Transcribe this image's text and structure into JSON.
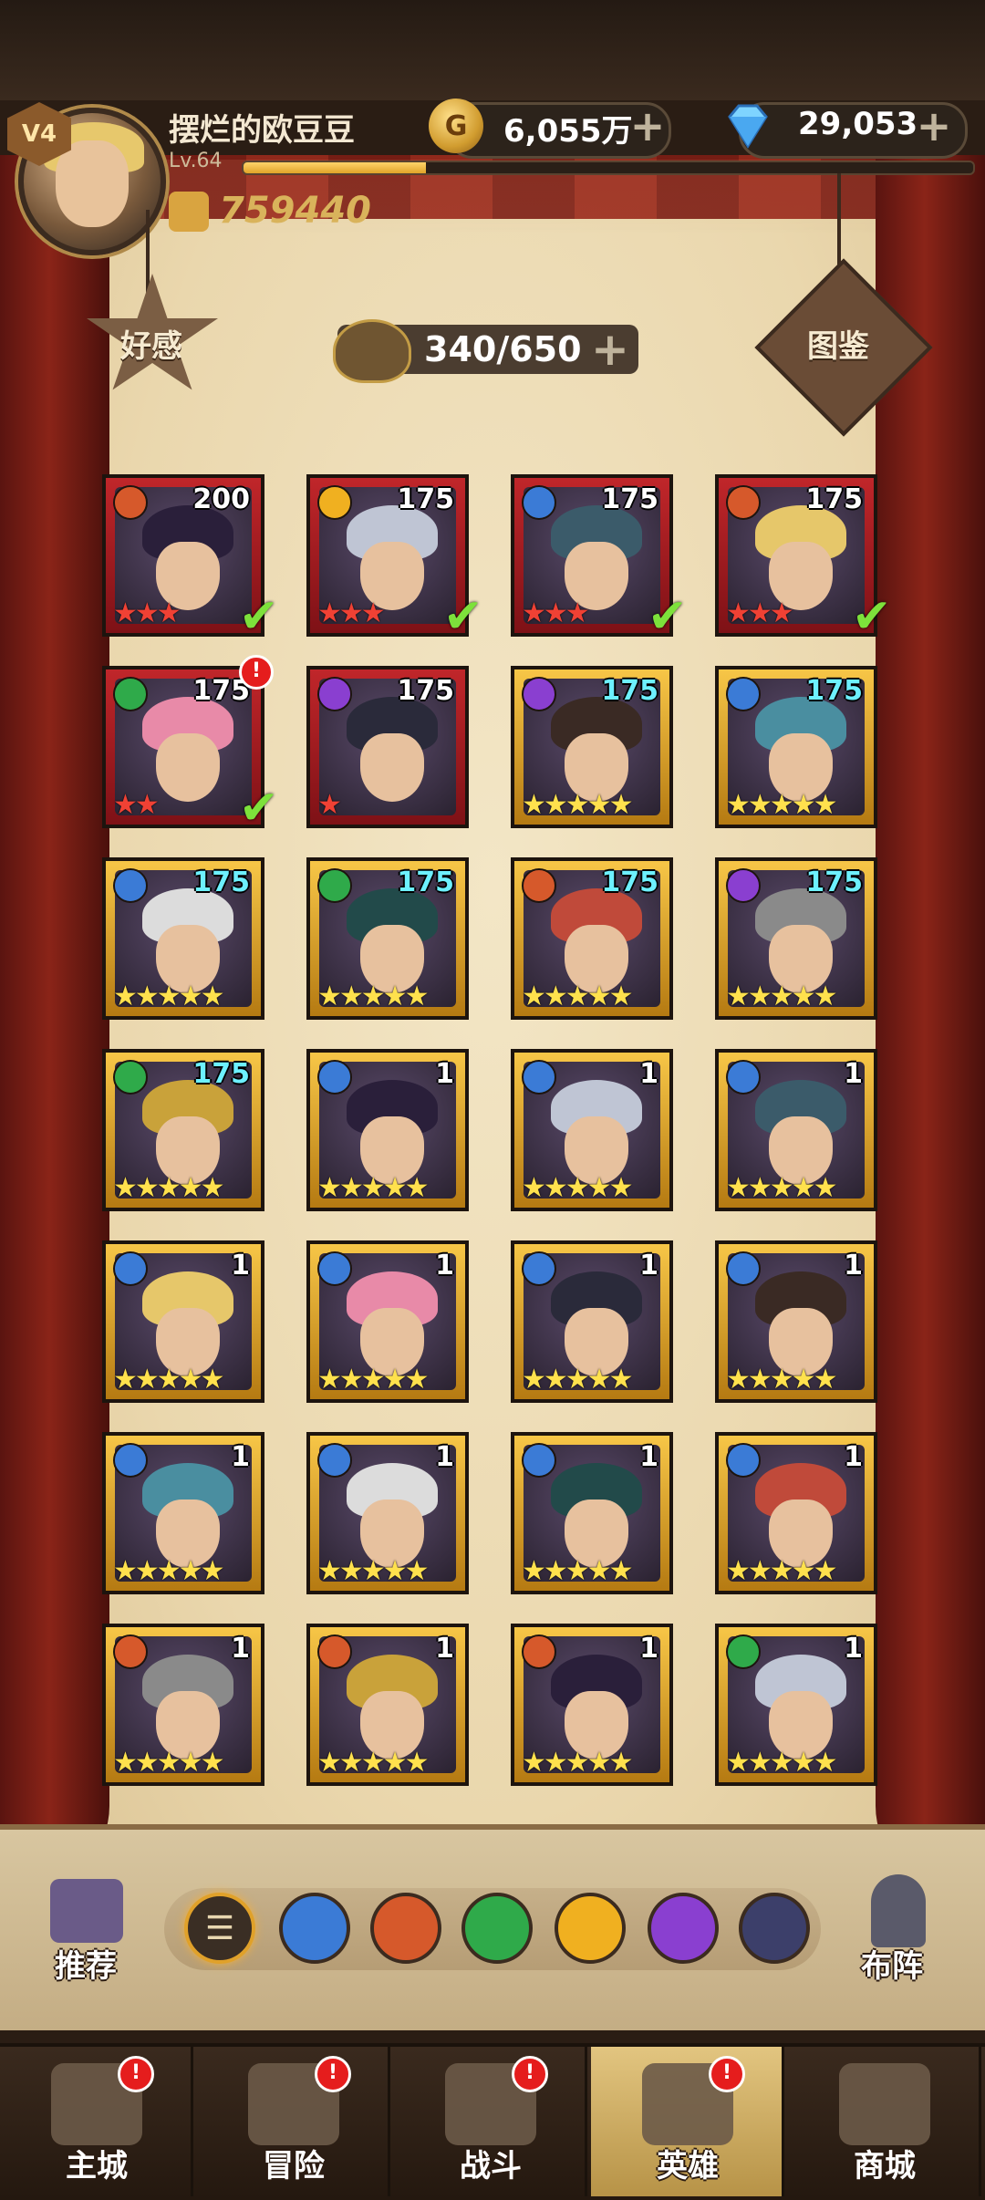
{
  "player": {
    "vip": "V4",
    "name": "摆烂的欧豆豆",
    "level": "Lv.64",
    "exp_fraction": 0.25,
    "power": "759440"
  },
  "resources": {
    "gold": "6,055万",
    "gems": "29,053",
    "plus": "+"
  },
  "buttons": {
    "favor": "好感",
    "codex": "图鉴"
  },
  "capacity": "340/650",
  "heroes": [
    {
      "level": "200",
      "frame": "red",
      "element": "fire",
      "stars": 3,
      "selected": true,
      "alert": false
    },
    {
      "level": "175",
      "frame": "red",
      "element": "light",
      "stars": 3,
      "selected": true,
      "alert": false
    },
    {
      "level": "175",
      "frame": "red",
      "element": "water",
      "stars": 3,
      "selected": true,
      "alert": false
    },
    {
      "level": "175",
      "frame": "red",
      "element": "fire",
      "stars": 3,
      "selected": true,
      "alert": false
    },
    {
      "level": "175",
      "frame": "red",
      "element": "wind",
      "stars": 2,
      "selected": true,
      "alert": true
    },
    {
      "level": "175",
      "frame": "red",
      "element": "dark",
      "stars": 1,
      "selected": false,
      "alert": false
    },
    {
      "level": "175",
      "frame": "gold",
      "element": "dark",
      "stars": 5,
      "selected": false,
      "alert": false
    },
    {
      "level": "175",
      "frame": "gold",
      "element": "water",
      "stars": 5,
      "selected": false,
      "alert": false
    },
    {
      "level": "175",
      "frame": "gold",
      "element": "water",
      "stars": 5,
      "selected": false,
      "alert": false
    },
    {
      "level": "175",
      "frame": "gold",
      "element": "wind",
      "stars": 5,
      "selected": false,
      "alert": false
    },
    {
      "level": "175",
      "frame": "gold",
      "element": "fire",
      "stars": 5,
      "selected": false,
      "alert": false
    },
    {
      "level": "175",
      "frame": "gold",
      "element": "dark",
      "stars": 5,
      "selected": false,
      "alert": false
    },
    {
      "level": "175",
      "frame": "gold",
      "element": "wind",
      "stars": 5,
      "selected": false,
      "alert": false
    },
    {
      "level": "1",
      "frame": "gold",
      "element": "water",
      "stars": 5,
      "selected": false,
      "alert": false
    },
    {
      "level": "1",
      "frame": "gold",
      "element": "water",
      "stars": 5,
      "selected": false,
      "alert": false
    },
    {
      "level": "1",
      "frame": "gold",
      "element": "water",
      "stars": 5,
      "selected": false,
      "alert": false
    },
    {
      "level": "1",
      "frame": "gold",
      "element": "water",
      "stars": 5,
      "selected": false,
      "alert": false
    },
    {
      "level": "1",
      "frame": "gold",
      "element": "water",
      "stars": 5,
      "selected": false,
      "alert": false
    },
    {
      "level": "1",
      "frame": "gold",
      "element": "water",
      "stars": 5,
      "selected": false,
      "alert": false
    },
    {
      "level": "1",
      "frame": "gold",
      "element": "water",
      "stars": 5,
      "selected": false,
      "alert": false
    },
    {
      "level": "1",
      "frame": "gold",
      "element": "water",
      "stars": 5,
      "selected": false,
      "alert": false
    },
    {
      "level": "1",
      "frame": "gold",
      "element": "water",
      "stars": 5,
      "selected": false,
      "alert": false
    },
    {
      "level": "1",
      "frame": "gold",
      "element": "water",
      "stars": 5,
      "selected": false,
      "alert": false
    },
    {
      "level": "1",
      "frame": "gold",
      "element": "water",
      "stars": 5,
      "selected": false,
      "alert": false
    },
    {
      "level": "1",
      "frame": "gold",
      "element": "fire",
      "stars": 5,
      "selected": false,
      "alert": false
    },
    {
      "level": "1",
      "frame": "gold",
      "element": "fire",
      "stars": 5,
      "selected": false,
      "alert": false
    },
    {
      "level": "1",
      "frame": "gold",
      "element": "fire",
      "stars": 5,
      "selected": false,
      "alert": false
    },
    {
      "level": "1",
      "frame": "gold",
      "element": "wind",
      "stars": 5,
      "selected": false,
      "alert": false
    }
  ],
  "level_color": {
    "cyan": "#6df0ff",
    "white": "#ffffff"
  },
  "filters": [
    "all",
    "water",
    "fire",
    "wind",
    "light",
    "dark",
    "void"
  ],
  "side": {
    "recommend": "推荐",
    "formation": "布阵"
  },
  "nav": [
    {
      "label": "主城",
      "icon": "castle-icon",
      "badge": "!",
      "active": false
    },
    {
      "label": "冒险",
      "icon": "ship-icon",
      "badge": "!",
      "active": false
    },
    {
      "label": "战斗",
      "icon": "swords-icon",
      "badge": "!",
      "active": false
    },
    {
      "label": "英雄",
      "icon": "helmet-icon",
      "badge": "!",
      "active": true
    },
    {
      "label": "商城",
      "icon": "shop-icon",
      "badge": "",
      "active": false
    }
  ],
  "colors": {
    "accent_gold": "#e0a12a",
    "red_frame": "#c0262a",
    "gold_frame": "#f7c647",
    "check": "#7de13b",
    "alert": "#e51d1d"
  }
}
